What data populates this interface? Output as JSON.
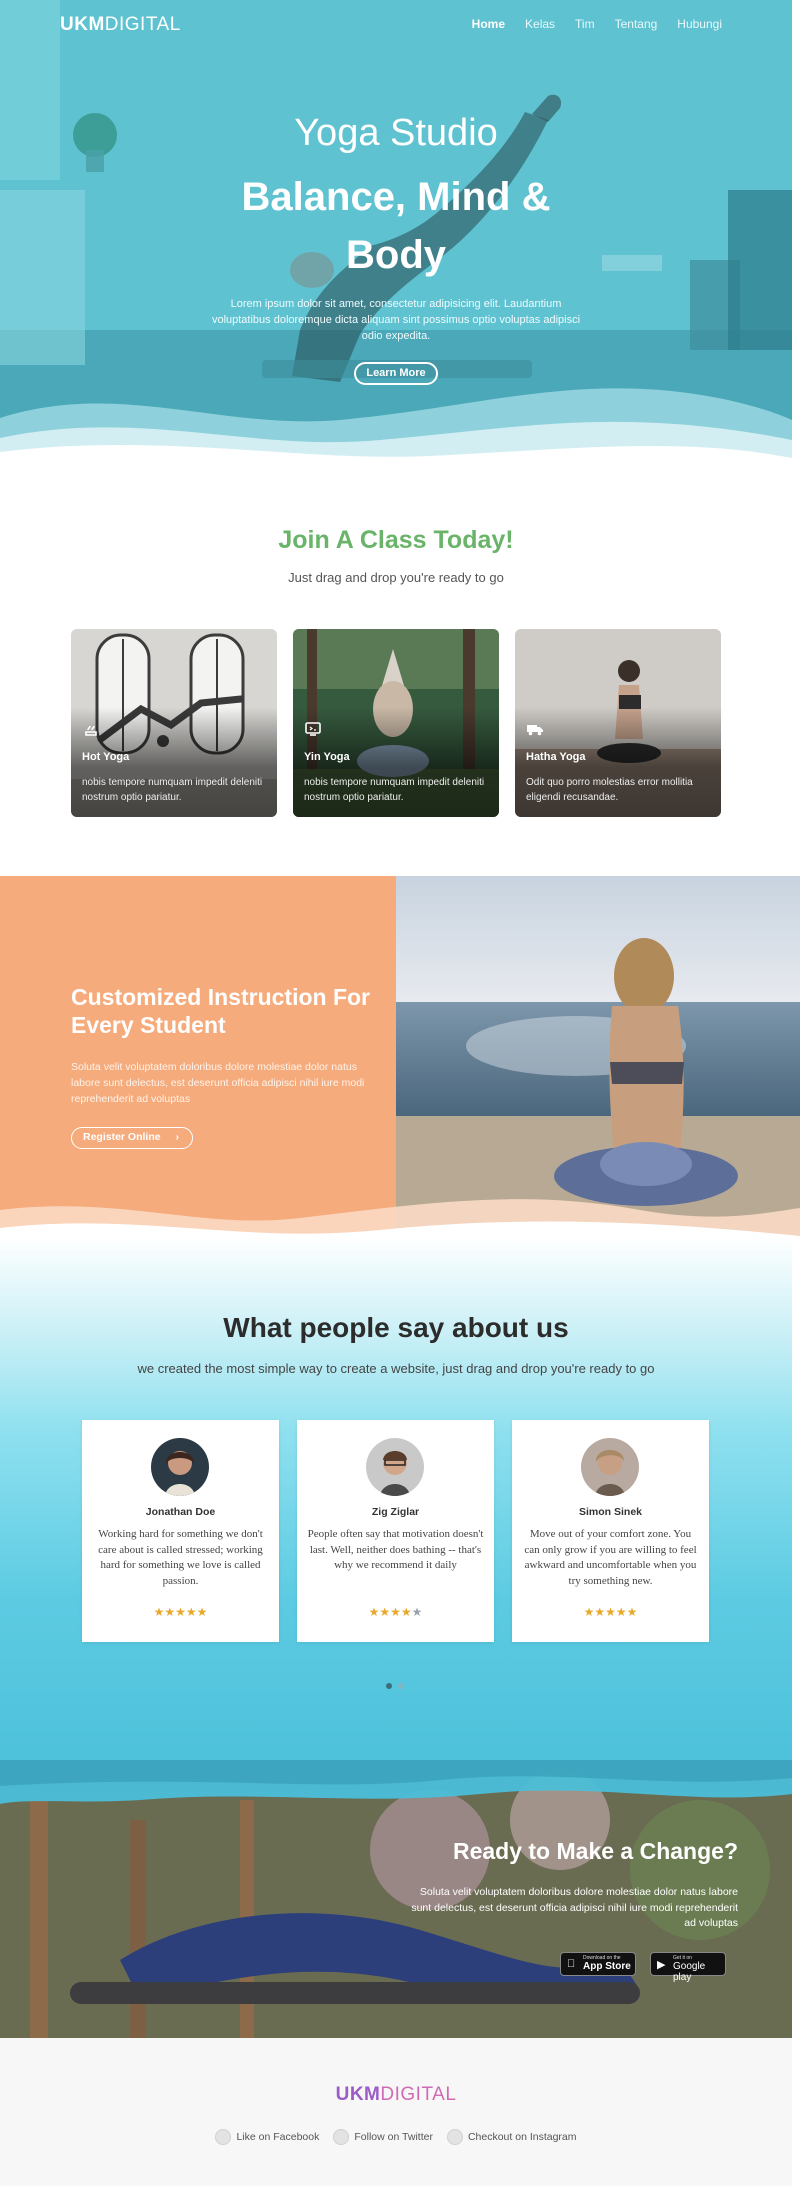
{
  "header": {
    "logo_bold": "UKM",
    "logo_light": "DIGITAL",
    "nav": [
      "Home",
      "Kelas",
      "Tim",
      "Tentang",
      "Hubungi"
    ]
  },
  "hero": {
    "subtitle": "Yoga Studio",
    "title_line1": "Balance, Mind &",
    "title_line2": "Body",
    "text": "Lorem ipsum dolor sit amet, consectetur adipisicing elit. Laudantium voluptatibus doloremque dicta aliquam sint possimus optio voluptas adipisci odio expedita.",
    "button": "Learn More"
  },
  "join": {
    "title": "Join A Class Today!",
    "subtitle": "Just drag and drop you're ready to go",
    "cards": [
      {
        "title": "Hot Yoga",
        "text": "nobis tempore numquam impedit deleniti nostrum optio pariatur.",
        "icon": "steam-icon"
      },
      {
        "title": "Yin Yoga",
        "text": "nobis tempore numquam impedit deleniti nostrum optio pariatur.",
        "icon": "screen-icon"
      },
      {
        "title": "Hatha Yoga",
        "text": "Odit quo porro molestias error mollitia eligendi recusandae.",
        "icon": "truck-icon"
      }
    ]
  },
  "custom": {
    "title": "Customized Instruction For Every Student",
    "text": "Soluta velit voluptatem doloribus dolore molestiae dolor natus labore sunt delectus, est deserunt officia adipisci nihil iure modi reprehenderit ad voluptas",
    "button": "Register Online",
    "button_chevron": "›"
  },
  "testimonials": {
    "title": "What people say about us",
    "subtitle": "we created the most simple way to create a website, just drag and drop you're ready to go",
    "items": [
      {
        "name": "Jonathan Doe",
        "quote": "Working hard for something we don't care about is called stressed; working hard for something we love is called passion.",
        "rating": 5
      },
      {
        "name": "Zig Ziglar",
        "quote": "People often say that motivation doesn't last. Well, neither does bathing -- that's why we recommend it daily",
        "rating": 4
      },
      {
        "name": "Simon Sinek",
        "quote": "Move out of your comfort zone. You can only grow if you are willing to feel awkward and uncomfortable when you try something new.",
        "rating": 5
      }
    ],
    "carousel_active": 1,
    "carousel_total": 2
  },
  "cta": {
    "title": "Ready to Make a Change?",
    "text": "Soluta velit voluptatem doloribus dolore molestiae dolor natus labore sunt delectus, est deserunt officia adipisci nihil iure modi reprehenderit ad voluptas",
    "app_store_small": "Download on the",
    "app_store_big": "App Store",
    "google_small": "Get it on",
    "google_big": "Google play"
  },
  "footer": {
    "logo_bold": "UKM",
    "logo_light": "DIGITAL",
    "links": [
      "Like on Facebook",
      "Follow on Twitter",
      "Checkout on Instagram"
    ]
  },
  "colors": {
    "hero_teal": "#55b9c8",
    "join_green": "#69b469",
    "custom_orange": "#f5ab7c",
    "testimonial_blue": "#4bbfd9",
    "star": "#e8a92a",
    "footer_logo": "#9b5cc8"
  }
}
